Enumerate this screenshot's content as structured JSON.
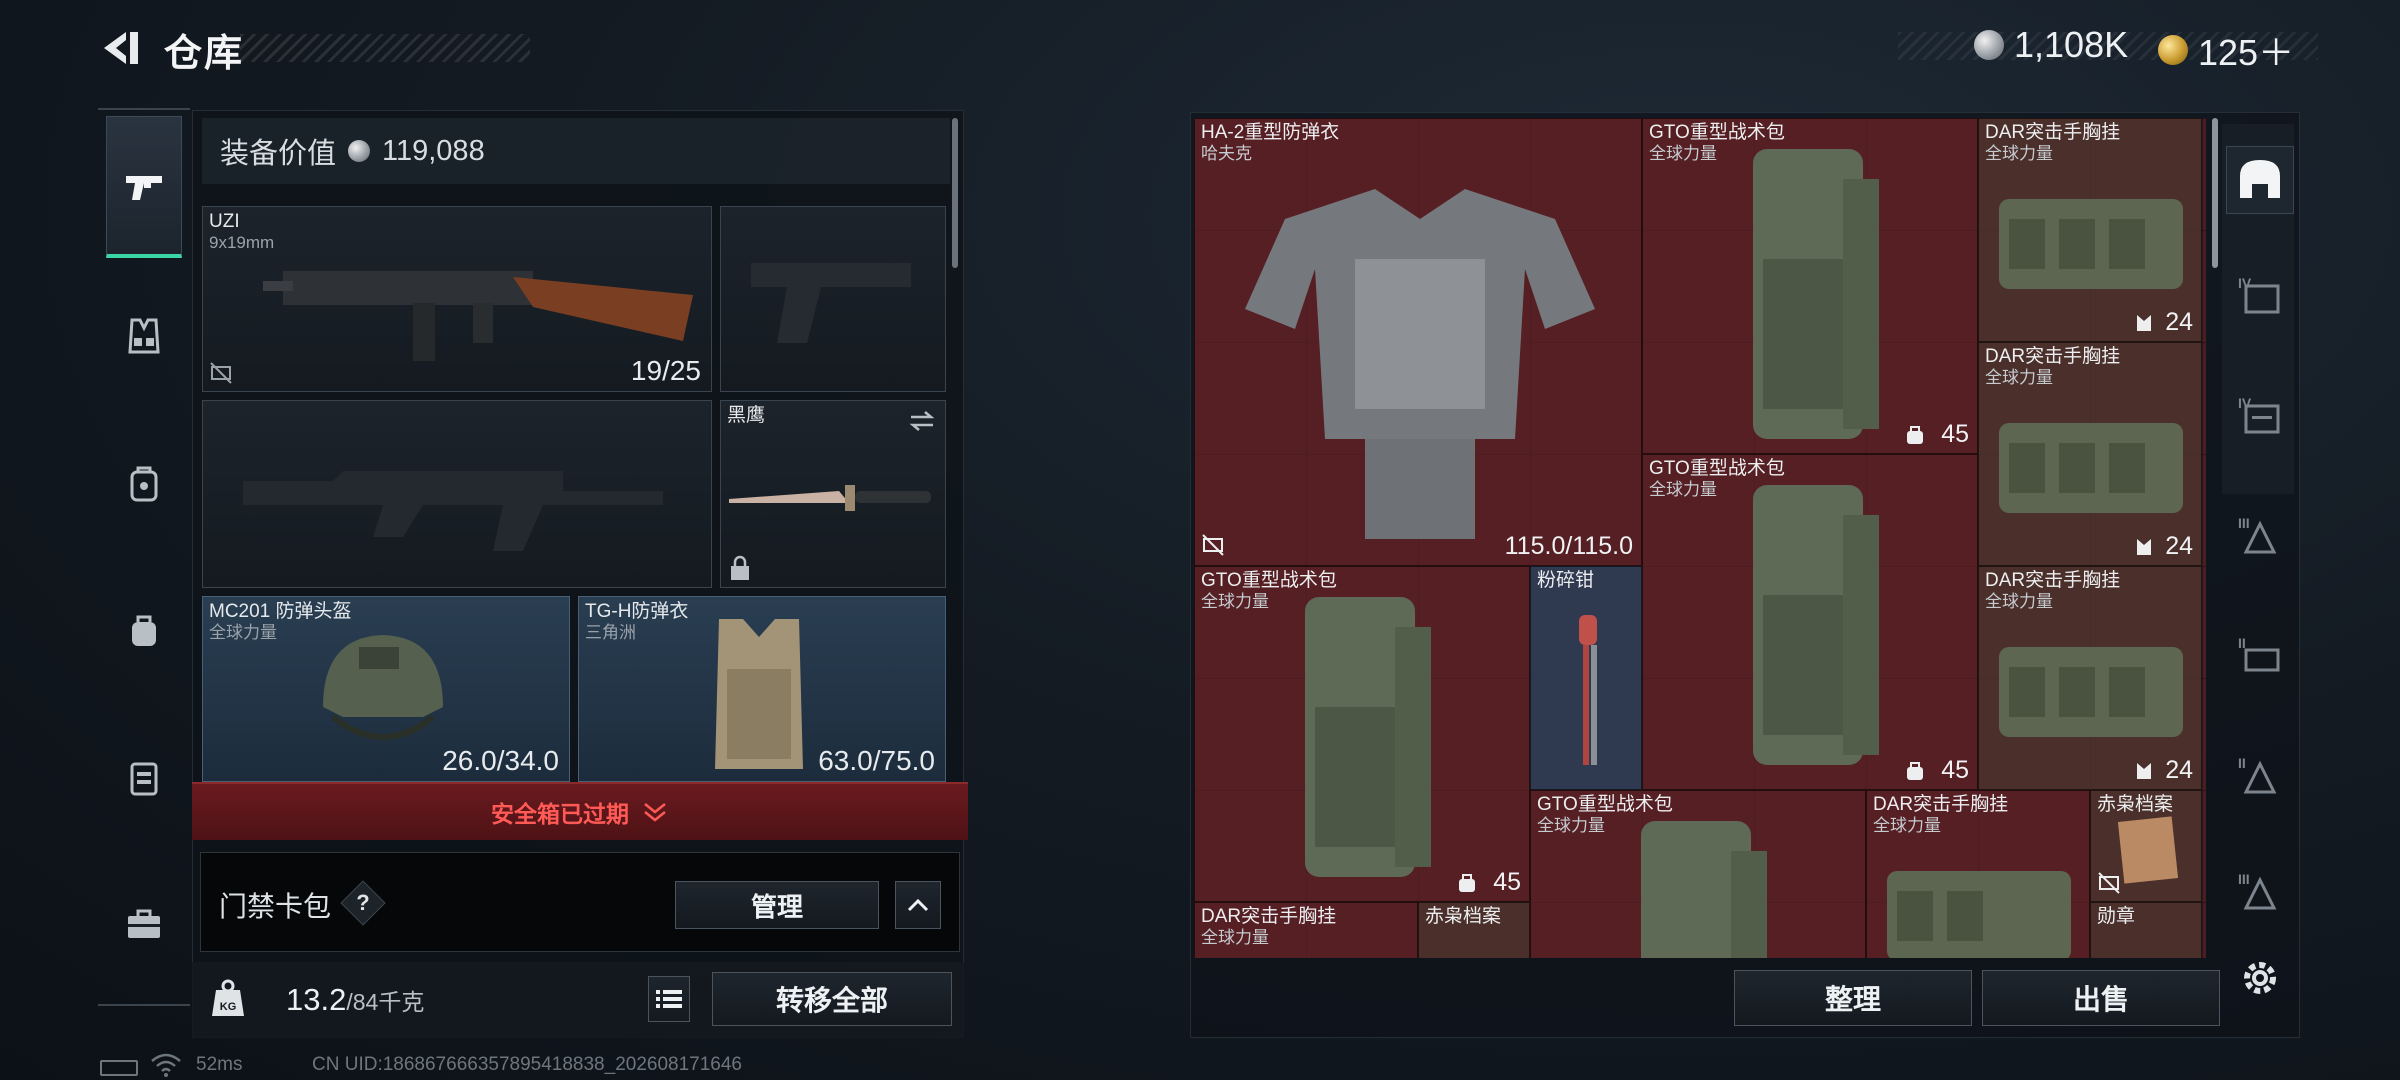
{
  "header": {
    "title": "仓库",
    "back_icon": "back-arrow-icon"
  },
  "currency": {
    "silver_value": "1,108K",
    "gold_value": "125＋"
  },
  "left_tabs": [
    "pistol-icon",
    "vest-icon",
    "backpack-icon",
    "pouch-icon",
    "case-icon",
    "toolbox-icon"
  ],
  "equip": {
    "label": "装备价值",
    "value": "119,088"
  },
  "slots": {
    "primary": {
      "name": "UZI",
      "sub": "9x19mm",
      "value": "19/25"
    },
    "melee": {
      "name": "黑鹰"
    },
    "helmet": {
      "name": "MC201 防弹头盔",
      "sub": "全球力量",
      "value": "26.0/34.0"
    },
    "armor": {
      "name": "TG-H防弹衣",
      "sub": "三角洲",
      "value": "63.0/75.0"
    }
  },
  "safebox": {
    "text": "安全箱已过期"
  },
  "keycard": {
    "label": "门禁卡包",
    "help": "?",
    "manage": "管理"
  },
  "weight": {
    "current": "13.2",
    "max": "/84千克",
    "transfer": "转移全部"
  },
  "status": {
    "ping": "52ms",
    "uid": "CN UID:1868676663578954188​38_202608171646"
  },
  "items": [
    {
      "name": "HA-2重型防弹衣",
      "sub": "哈夫克",
      "value": "115.0/115.0"
    },
    {
      "name": "GTO重型战术包",
      "sub": "全球力量",
      "value": "45"
    },
    {
      "name": "DAR突击手胸挂",
      "sub": "全球力量",
      "value": "24"
    },
    {
      "name": "DAR突击手胸挂",
      "sub": "全球力量",
      "value": "24"
    },
    {
      "name": "GTO重型战术包",
      "sub": "全球力量",
      "value": "45"
    },
    {
      "name": "DAR突击手胸挂",
      "sub": "全球力量",
      "value": "24"
    },
    {
      "name": "GTO重型战术包",
      "sub": "全球力量",
      "value": "45"
    },
    {
      "name": "粉碎钳",
      "sub": "",
      "value": ""
    },
    {
      "name": "GTO重型战术包",
      "sub": "全球力量",
      "value": ""
    },
    {
      "name": "DAR突击手胸挂",
      "sub": "全球力量",
      "value": ""
    },
    {
      "name": "赤枭档案",
      "sub": "",
      "value": ""
    },
    {
      "name": "DAR突击手胸挂",
      "sub": "全球力量",
      "value": ""
    },
    {
      "name": "赤枭档案",
      "sub": "",
      "value": ""
    },
    {
      "name": "勋章",
      "sub": "",
      "value": ""
    }
  ],
  "actions": {
    "sort": "整理",
    "sell": "出售"
  },
  "right_tabs": [
    "helmet-icon",
    "armor-tier-4-icon",
    "rig-tier-4-icon",
    "backpack-tier-3-icon",
    "gun-tier-2-icon",
    "rig-tier-2-icon",
    "backpack-tier-2-icon",
    "settings-icon"
  ]
}
